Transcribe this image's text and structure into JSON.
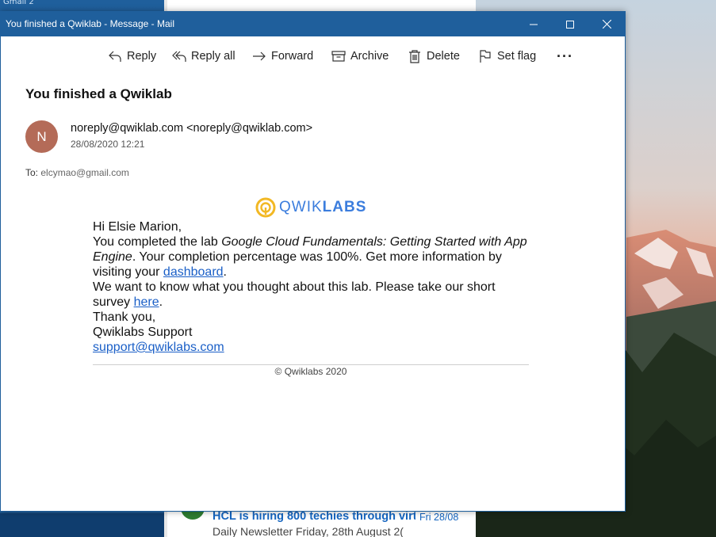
{
  "window": {
    "title": "You finished a Qwiklab - Message - Mail"
  },
  "toolbar": {
    "reply": "Reply",
    "reply_all": "Reply all",
    "forward": "Forward",
    "archive": "Archive",
    "delete": "Delete",
    "set_flag": "Set flag",
    "more": "···"
  },
  "message": {
    "subject": "You finished a Qwiklab",
    "avatar_initial": "N",
    "sender": "noreply@qwiklab.com <noreply@qwiklab.com>",
    "date": "28/08/2020 12:21",
    "to_label": "To:",
    "to_address": "elcymao@gmail.com"
  },
  "body": {
    "logo_light": "QWIK",
    "logo_bold": "LABS",
    "greeting": "Hi Elsie Marion,",
    "line1_prefix": "You completed the lab ",
    "lab_name": "Google Cloud Fundamentals: Getting Started with App Engine",
    "line1_suffix": ". Your completion percentage was 100%. Get more information by visiting your ",
    "dashboard_link": "dashboard",
    "period": ".",
    "survey_prefix": "We want to know what you thought about this lab. Please take our short survey ",
    "survey_link": "here",
    "thanks": "Thank you,",
    "signature": "Qwiklabs Support",
    "support_email": "support@qwiklabs.com",
    "copyright": "© Qwiklabs 2020"
  },
  "background_app": {
    "left_pane_text": "Gmail 2",
    "list_item_subject": "HCL is hiring 800 techies through virt",
    "list_item_date": "Fri 28/08",
    "list_item_preview": "Daily Newsletter Friday, 28th August 2("
  },
  "colors": {
    "titlebar": "#1f5f9c",
    "avatar": "#b46b58",
    "link": "#1a5fc7",
    "logo_blue": "#3b7ddd",
    "logo_yellow": "#f2b824"
  }
}
